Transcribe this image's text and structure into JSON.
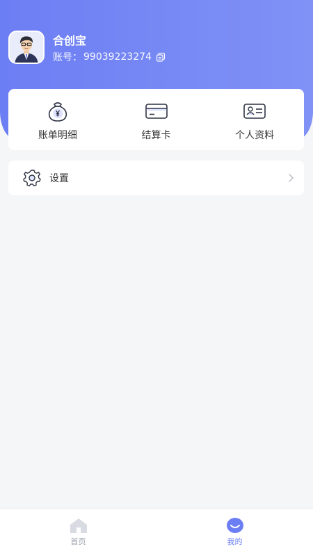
{
  "profile": {
    "name": "合创宝",
    "account_label": "账号：",
    "account_number": "99039223274"
  },
  "quick_menu": {
    "items": [
      {
        "label": "账单明细",
        "icon": "money-bag-icon"
      },
      {
        "label": "结算卡",
        "icon": "bank-card-icon"
      },
      {
        "label": "个人资料",
        "icon": "id-card-icon"
      }
    ]
  },
  "settings": {
    "label": "设置",
    "icon": "gear-icon"
  },
  "tabbar": {
    "tabs": [
      {
        "label": "首页",
        "icon": "home-icon",
        "active": false
      },
      {
        "label": "我的",
        "icon": "smile-icon",
        "active": true
      }
    ]
  },
  "colors": {
    "accent": "#6c7ef3",
    "header_gradient_end": "#8092f6",
    "background": "#f5f6f8",
    "icon_stroke": "#2f3444",
    "tab_inactive": "#9aa0aa"
  }
}
